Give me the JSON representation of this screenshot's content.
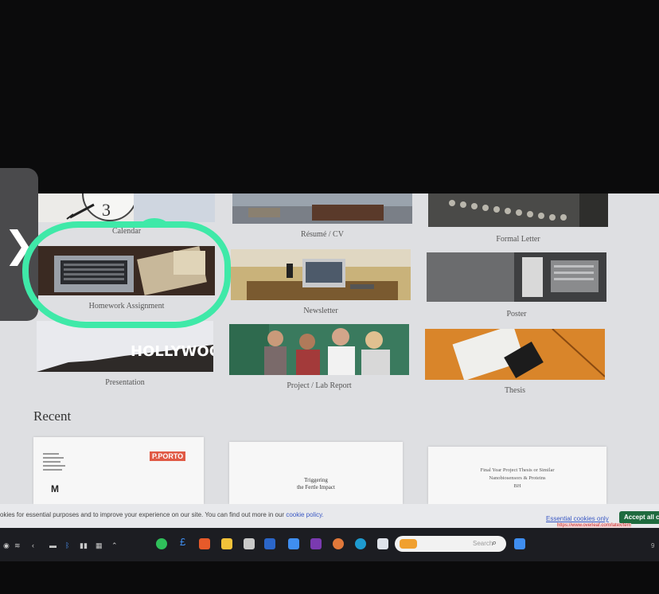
{
  "side_tab": {
    "icon": "chevron-right-icon",
    "glyph": "❯"
  },
  "templates": [
    {
      "label": "Calendar",
      "name": "tile-calendar"
    },
    {
      "label": "Résumé / CV",
      "name": "tile-resume-cv"
    },
    {
      "label": "Formal Letter",
      "name": "tile-formal-letter"
    },
    {
      "label": "Homework Assignment",
      "name": "tile-homework-assignment"
    },
    {
      "label": "Newsletter",
      "name": "tile-newsletter"
    },
    {
      "label": "Poster",
      "name": "tile-poster"
    },
    {
      "label": "Presentation",
      "name": "tile-presentation"
    },
    {
      "label": "Project / Lab Report",
      "name": "tile-project-lab-report"
    },
    {
      "label": "Thesis",
      "name": "tile-thesis"
    }
  ],
  "thumb_text": {
    "clock_numeral": "3",
    "hollywood": "HOLLYWOOD"
  },
  "recent": {
    "heading": "Recent",
    "docs": [
      {
        "brand": "P.PORTO",
        "initial": "M"
      },
      {
        "title_line1": "Triggering",
        "title_line2": "the Fertle Impact"
      },
      {
        "line1": "Final Year Project Thesis or Similar",
        "line2": "Nanobiosensors & Proteins",
        "line3": "BH"
      }
    ]
  },
  "cookie": {
    "message": "okies for essential purposes and to improve your experience on our site. You can find out more in our ",
    "policy_link": "cookie policy.",
    "essential_only": "Essential cookies only",
    "accept_all": "Accept all c",
    "url_hint": "https://www.overleaf.com/latex/tem"
  },
  "taskbar": {
    "search_placeholder": "Search",
    "time": "9"
  },
  "colors": {
    "highlight": "#3fe9a8",
    "accept_button": "#1f6b3f",
    "link": "#3b59c4",
    "pporto": "#e05a45"
  }
}
